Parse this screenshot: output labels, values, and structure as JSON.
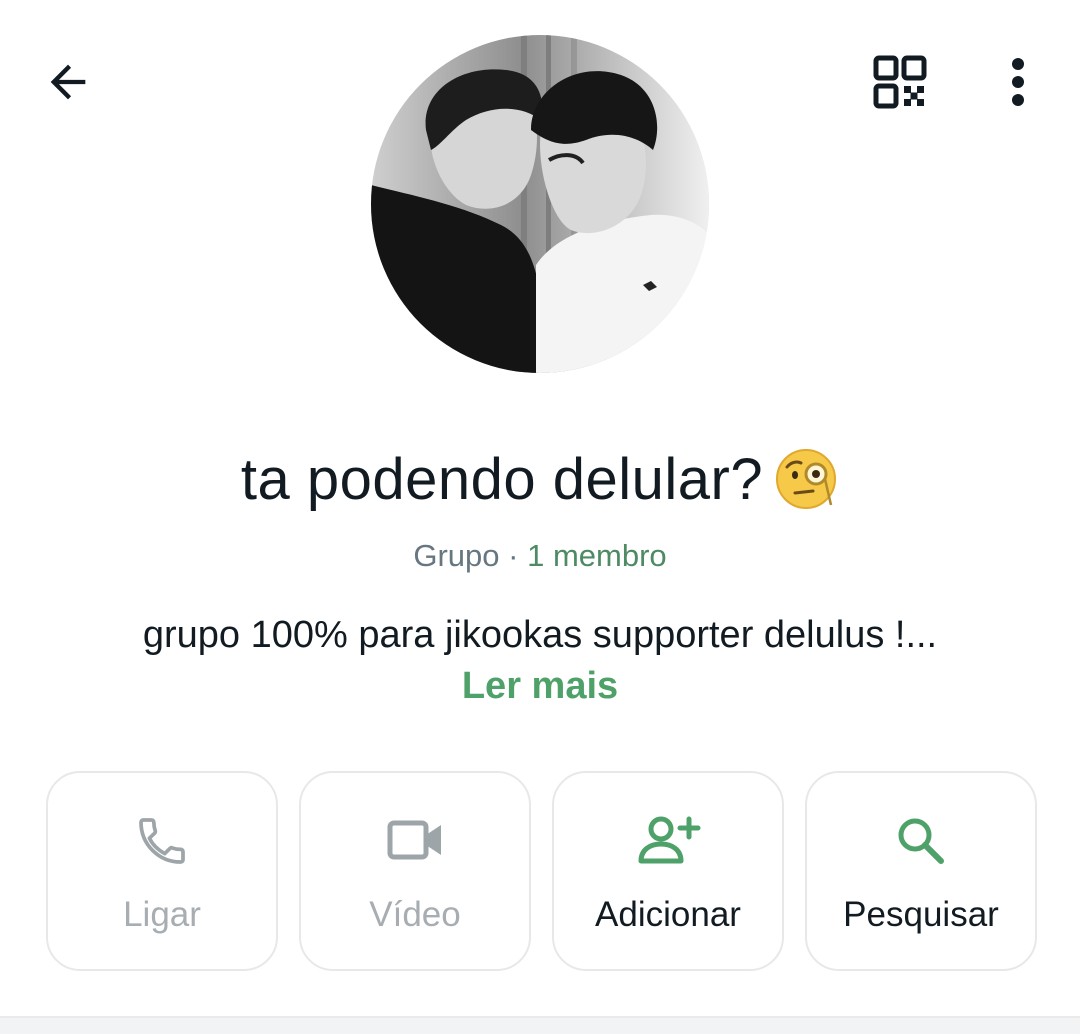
{
  "header": {
    "back_icon": "arrow-left-icon",
    "qr_icon": "qr-code-icon",
    "more_icon": "more-vertical-icon"
  },
  "profile": {
    "group_name": "ta podendo delular?",
    "name_emoji": "face-with-monocle",
    "type_label": "Grupo",
    "separator": "·",
    "members_label": "1 membro",
    "description": "grupo 100% para jikookas supporter delulus !...",
    "read_more": "Ler mais"
  },
  "actions": [
    {
      "label": "Ligar",
      "icon": "phone-icon",
      "enabled": false
    },
    {
      "label": "Vídeo",
      "icon": "video-icon",
      "enabled": false
    },
    {
      "label": "Adicionar",
      "icon": "add-person-icon",
      "enabled": true
    },
    {
      "label": "Pesquisar",
      "icon": "search-icon",
      "enabled": true
    }
  ],
  "colors": {
    "accent": "#4fa16a",
    "text_primary": "#111b21",
    "text_secondary": "#667781",
    "disabled": "#a7adb1",
    "border": "#e6e8ea"
  }
}
